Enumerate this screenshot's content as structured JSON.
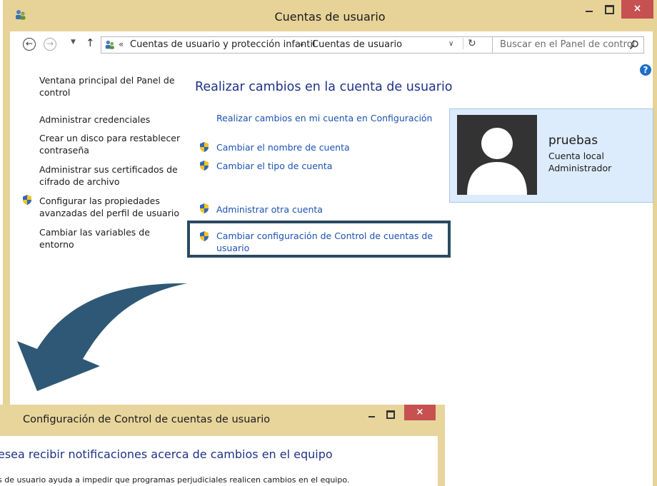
{
  "window": {
    "title": "Cuentas de usuario",
    "close_label": "×"
  },
  "nav": {
    "back_glyph": "←",
    "forward_glyph": "→",
    "recent_glyph": "▼",
    "up_glyph": "↑",
    "chevron": "«",
    "breadcrumb": [
      "Cuentas de usuario y protección infantil",
      "Cuentas de usuario"
    ],
    "breadcrumb_separator": "▸",
    "dropdown_glyph": "∨",
    "refresh_glyph": "↻",
    "search_placeholder": "Buscar en el Panel de control"
  },
  "help": {
    "glyph": "?"
  },
  "sidebar": {
    "items": [
      {
        "label_lines": [
          "Ventana principal del Panel de",
          "control"
        ],
        "shield": false
      },
      {
        "label_lines": [
          "Administrar credenciales"
        ],
        "shield": false
      },
      {
        "label_lines": [
          "Crear un disco para restablecer",
          "contraseña"
        ],
        "shield": false
      },
      {
        "label_lines": [
          "Administrar sus certificados de",
          "cifrado de archivo"
        ],
        "shield": false
      },
      {
        "label_lines": [
          "Configurar las propiedades",
          "avanzadas del perfil de usuario"
        ],
        "shield": true
      },
      {
        "label_lines": [
          "Cambiar las variables de",
          "entorno"
        ],
        "shield": false
      }
    ]
  },
  "main": {
    "title": "Realizar cambios en la cuenta de usuario",
    "tasks": [
      {
        "label_lines": [
          "Realizar cambios en mi cuenta en Configuración"
        ],
        "shield": false
      },
      {
        "label_lines": [
          "Cambiar el nombre de cuenta"
        ],
        "shield": true
      },
      {
        "label_lines": [
          "Cambiar el tipo de cuenta"
        ],
        "shield": true
      },
      {
        "label_lines": [
          "Administrar otra cuenta"
        ],
        "shield": true
      },
      {
        "label_lines": [
          "Cambiar configuración de Control de cuentas de",
          "usuario"
        ],
        "shield": true
      }
    ]
  },
  "profile": {
    "name": "pruebas",
    "account_type": "Cuenta local",
    "role": "Administrador"
  },
  "uac_window": {
    "title": "Configuración de Control de cuentas de usuario",
    "close_label": "×",
    "heading": "esea recibir notificaciones acerca de cambios en el equipo",
    "description": "s de usuario ayuda a impedir que programas perjudiciales realicen cambios en el equipo."
  },
  "colors": {
    "title_bar": "#e7d398",
    "close_button": "#c75050",
    "link": "#1b51b2",
    "heading": "#1e3287",
    "highlight_border": "#2b4a61",
    "profile_bg": "#dcecfc",
    "arrow": "#2e5876"
  }
}
